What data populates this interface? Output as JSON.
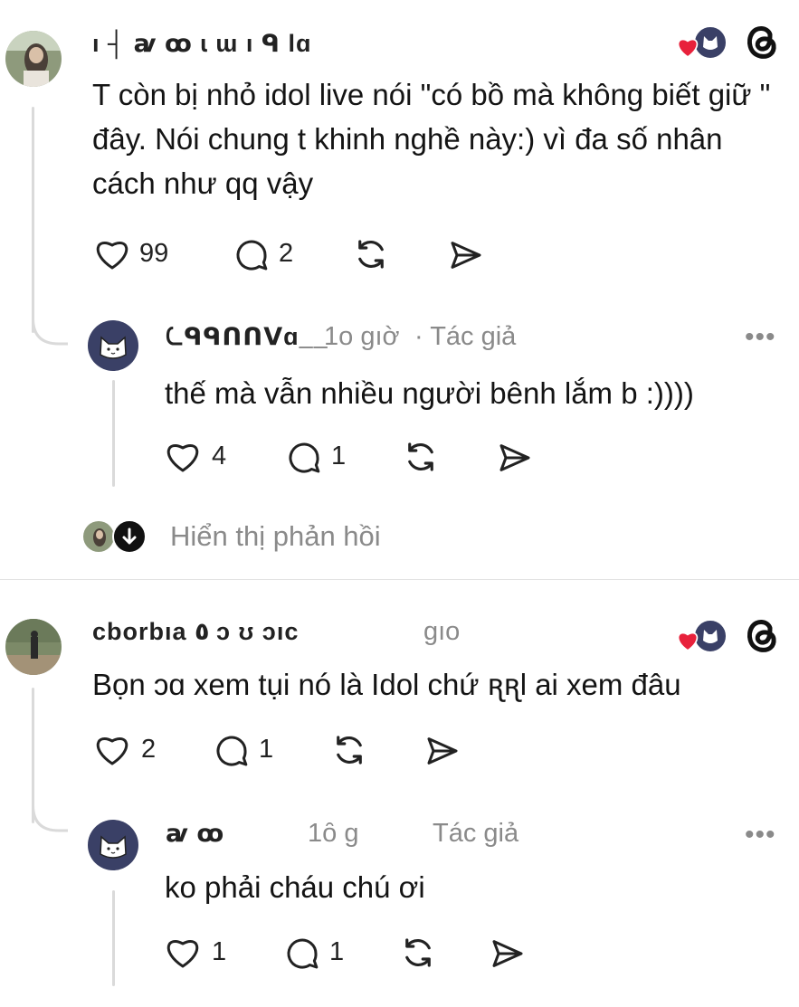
{
  "colors": {
    "heart_red": "#e8213b",
    "muted": "#8a8a8a",
    "cat_avatar_bg": "#3a4066"
  },
  "comments": [
    {
      "username": "ı ┤ ꜹ ꝏ ɩ ɯ ı ᑫ lɑ",
      "text": "T còn bị nhỏ idol live nói \"có bồ mà không biết giữ \" đây. Nói chung t khinh nghề này:) vì đa số nhân cách như qq vậy",
      "likes": "99",
      "replies": "2",
      "reply": {
        "username": "ᘇᑫᑫᑎᑎᐯɑ__",
        "time": "1o gıờ",
        "author_label": "· Tác giả",
        "more": "•••",
        "text": "thế mà vẫn nhiều người bênh lắm b :))))",
        "likes": "4",
        "replies": "1"
      },
      "show_replies": "Hiển thị phản hồi"
    },
    {
      "username": "cborbıa ٥ ɔ ʊ ɔıc",
      "time": "gıo",
      "text": "Bọn ɔɑ xem tụi nó là Idol chứ  ꭆꭆl ai xem đâu",
      "likes": "2",
      "replies": "1",
      "reply": {
        "username": "ꜹ ꝏ",
        "time": "1ȏ ɡ",
        "author_label": "Tác giả",
        "more": "•••",
        "text": "ko phải cháu chú ơi",
        "likes": "1",
        "replies": "1"
      }
    }
  ]
}
